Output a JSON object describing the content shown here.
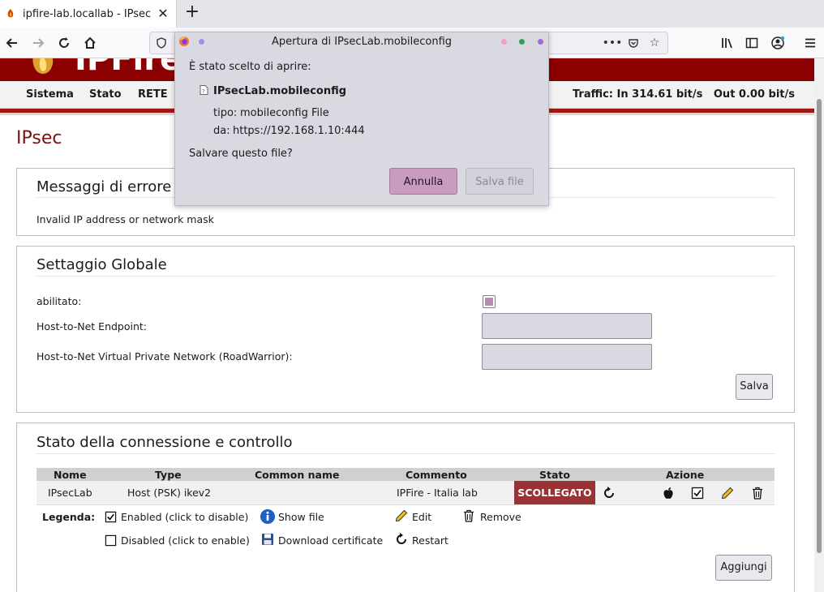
{
  "browser": {
    "tab_title": "ipfire-lab.locallab - IPsec",
    "new_tab_label": "+"
  },
  "site": {
    "logo_text": "IPFire",
    "menu": [
      "Sistema",
      "Stato",
      "RETE"
    ],
    "traffic": "Traffic: In 314.61 bit/s   Out 0.00 bit/s"
  },
  "page": {
    "title": "IPsec"
  },
  "errors": {
    "heading": "Messaggi di errore",
    "message": "Invalid IP address or network mask"
  },
  "global": {
    "heading": "Settaggio Globale",
    "enabled_label": "abilitato:",
    "endpoint_label": "Host-to-Net Endpoint:",
    "roadwarrior_label": "Host-to-Net Virtual Private Network (RoadWarrior):",
    "endpoint_value": "",
    "roadwarrior_value": "",
    "save_label": "Salva"
  },
  "connections": {
    "heading": "Stato della connessione e controllo",
    "columns": [
      "Nome",
      "Type",
      "Common name",
      "Commento",
      "Stato",
      "Azione"
    ],
    "rows": [
      {
        "name": "IPsecLab",
        "type": "Host (PSK) ikev2",
        "common_name": "",
        "comment": "IPFire - Italia lab",
        "status": "SCOLLEGATO"
      }
    ],
    "legend_title": "Legenda:",
    "legend": {
      "enabled": "Enabled (click to disable)",
      "disabled": "Disabled (click to enable)",
      "show_file": "Show file",
      "download_cert": "Download certificate",
      "edit": "Edit",
      "restart": "Restart",
      "remove": "Remove"
    },
    "add_label": "Aggiungi"
  },
  "dialog": {
    "title": "Apertura di IPsecLab.mobileconfig",
    "intro": "È stato scelto di aprire:",
    "filename": "IPsecLab.mobileconfig",
    "type_label": "tipo:",
    "type_value": "mobileconfig File",
    "from_label": "da:",
    "from_value": "https://192.168.1.10:444",
    "question": "Salvare questo file?",
    "cancel_label": "Annulla",
    "save_label": "Salva file"
  },
  "colors": {
    "brand_red": "#8b0000",
    "status_red": "#993333",
    "dialog_bg": "#d9d9e2",
    "cancel_btn": "#c89bbf"
  }
}
